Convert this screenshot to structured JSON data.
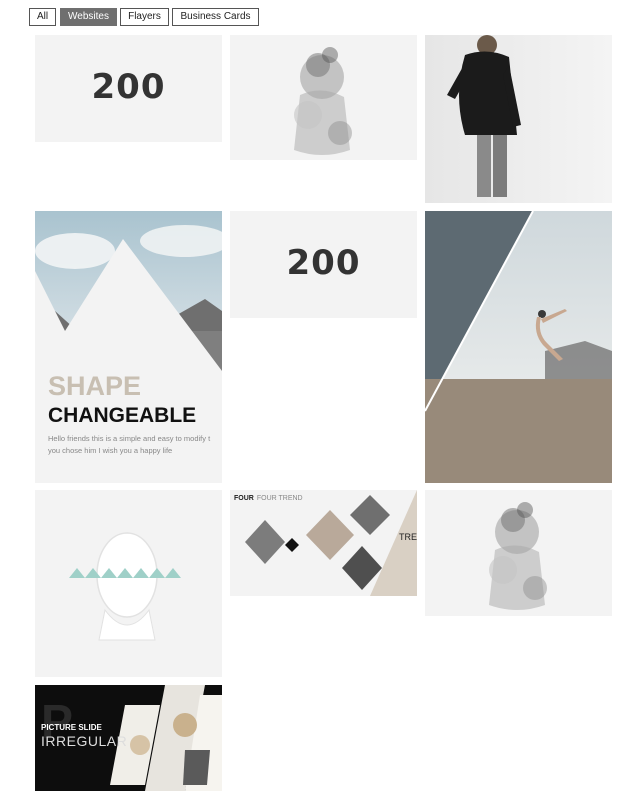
{
  "filters": {
    "all": "All",
    "websites": "Websites",
    "flayers": "Flayers",
    "business_cards": "Business Cards",
    "active": "Websites"
  },
  "tiles": {
    "t200_a": {
      "text": "200"
    },
    "t200_b": {
      "text": "200"
    },
    "shape": {
      "word1": "SHAPE",
      "word2": "CHANGEABLE",
      "body": "Hello friends this is a simple and easy to modify t you chose him I wish you a happy life"
    },
    "four": {
      "title": "FOUR",
      "subtitle": "FOUR TREND",
      "side": "TREND"
    },
    "picture": {
      "line1": "PICTURE SLIDE",
      "line2": "IRREGULAR",
      "big_letter": "P"
    }
  },
  "colors": {
    "active_filter": "#6f6f6f",
    "tile_bg": "#f3f3f3",
    "shape_accent": "#c8bfb2"
  }
}
